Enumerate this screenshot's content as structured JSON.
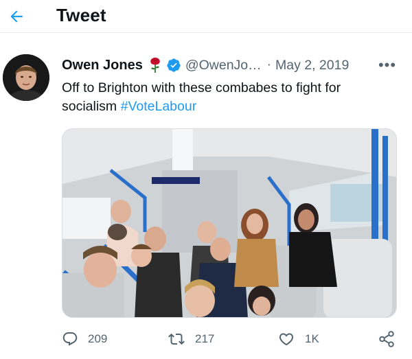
{
  "header": {
    "title": "Tweet",
    "back_icon": "arrow-left-icon"
  },
  "tweet": {
    "author_name": "Owen Jones",
    "handle": "@OwenJo…",
    "separator": "·",
    "date": "May 2, 2019",
    "more_label": "•••",
    "text_main": "Off to Brighton with these combabes to fight for socialism ",
    "hashtag": "#VoteLabour",
    "emoji_icon": "red-rose-icon",
    "verified_icon": "verified-badge-icon"
  },
  "actions": {
    "replies": "209",
    "retweets": "217",
    "likes": "1K"
  },
  "colors": {
    "accent": "#1d9bf0",
    "secondary_text": "#536471",
    "rose": "#c8102e"
  }
}
